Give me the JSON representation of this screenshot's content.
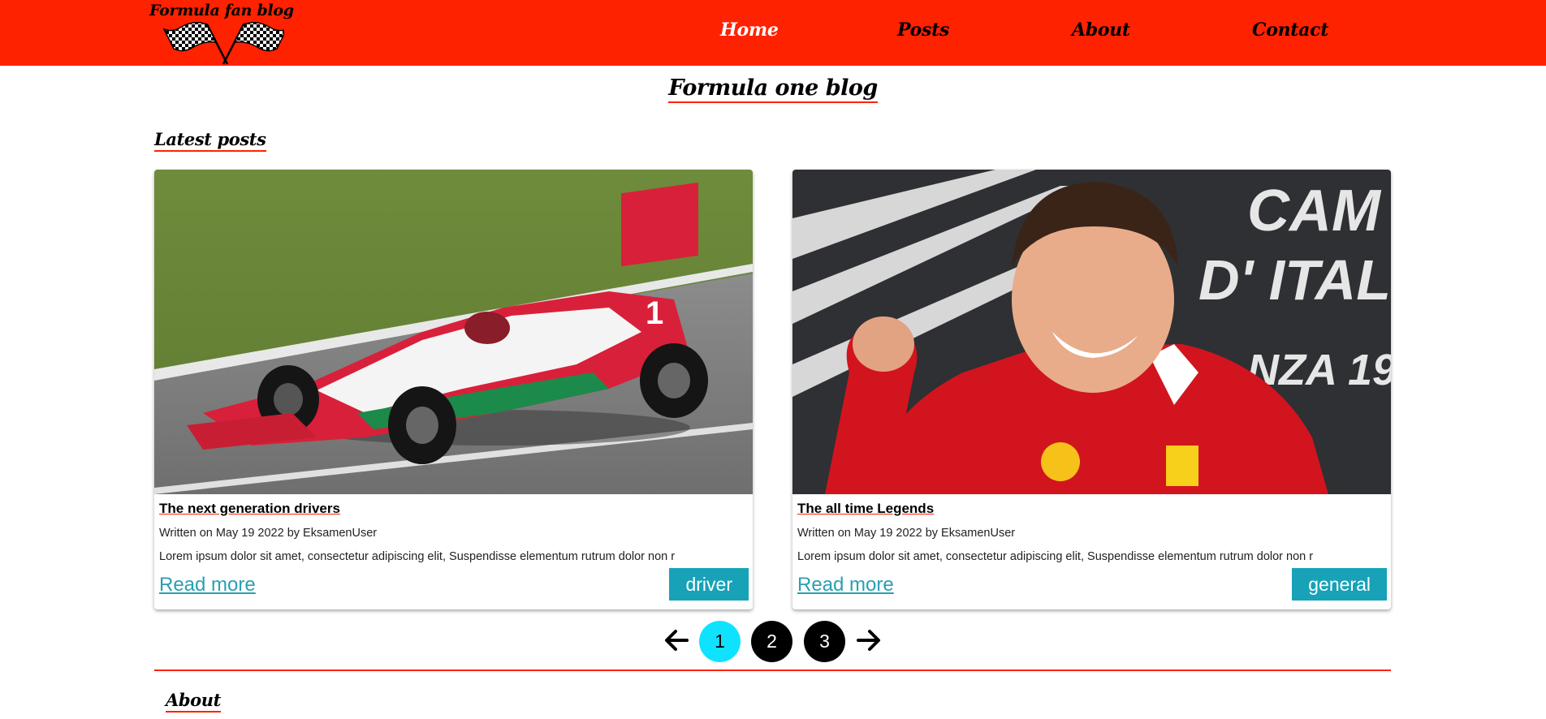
{
  "site": {
    "logo_text": "Formula fan blog",
    "accent_color": "#ff2200",
    "logo_icon": "checkered-flags-icon"
  },
  "nav": {
    "items": [
      {
        "label": "Home",
        "active": true
      },
      {
        "label": "Posts",
        "active": false
      },
      {
        "label": "About",
        "active": false
      },
      {
        "label": "Contact",
        "active": false
      }
    ]
  },
  "main": {
    "title": "Formula one blog",
    "latest_heading": "Latest posts",
    "about_heading": "About"
  },
  "posts": [
    {
      "image": "formula-car-photo",
      "title": "The next generation drivers",
      "meta": "Written on May 19 2022 by EksamenUser",
      "excerpt": "Lorem ipsum dolor sit amet, consectetur adipiscing elit, Suspendisse elementum rutrum dolor non r",
      "read_more": "Read more",
      "tag": "driver"
    },
    {
      "image": "driver-celebrating-photo",
      "title": "The all time Legends",
      "meta": "Written on May 19 2022 by EksamenUser",
      "excerpt": "Lorem ipsum dolor sit amet, consectetur adipiscing elit, Suspendisse elementum rutrum dolor non r",
      "read_more": "Read more",
      "tag": "general"
    }
  ],
  "pagination": {
    "prev_icon": "arrow-left-icon",
    "next_icon": "arrow-right-icon",
    "pages": [
      "1",
      "2",
      "3"
    ],
    "current": "1",
    "active_color": "#0fe2ff"
  }
}
